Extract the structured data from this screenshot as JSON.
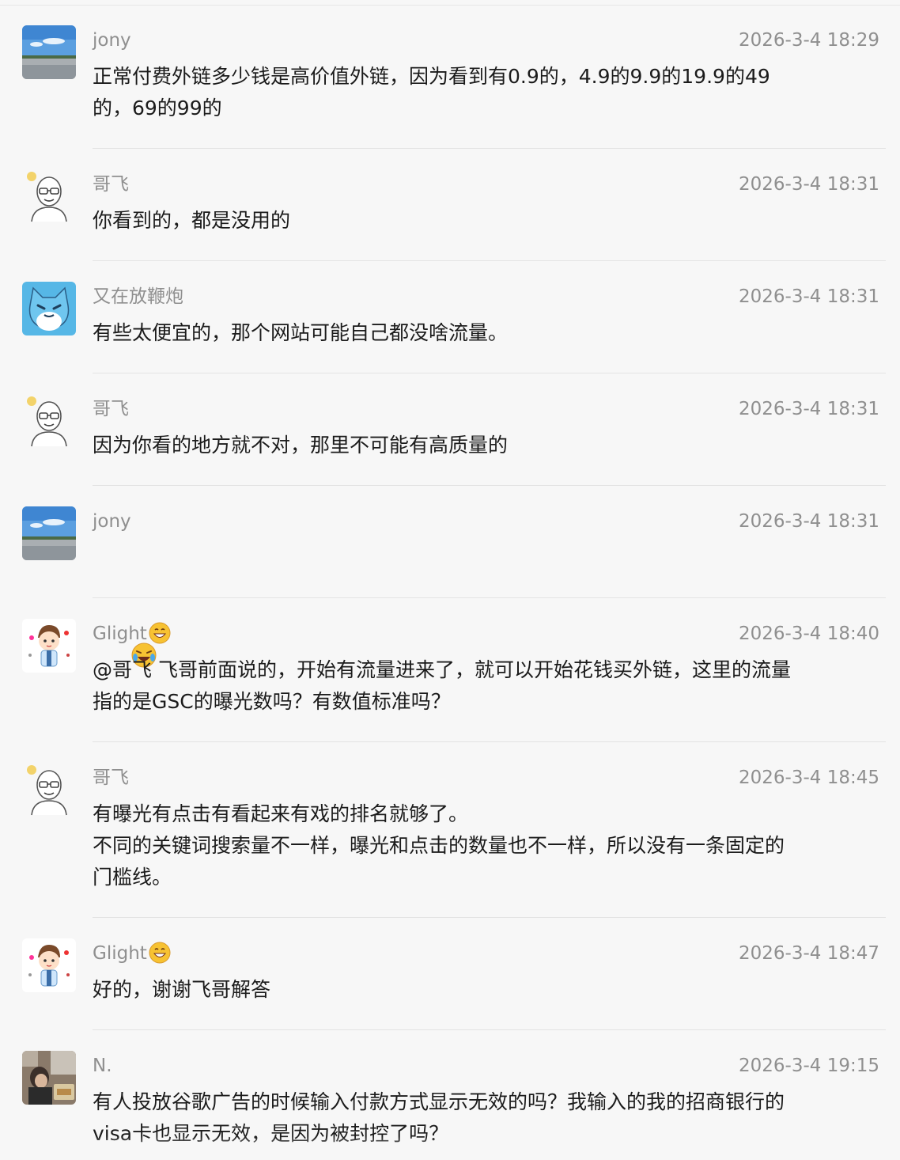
{
  "messages": [
    {
      "name": "jony",
      "time": "2026-3-4 18:29",
      "text": "正常付费外链多少钱是高价值外链，因为看到有0.9的，4.9的9.9的19.9的49\n的，69的99的",
      "avatar": "lake-avatar"
    },
    {
      "name": "哥飞",
      "time": "2026-3-4 18:31",
      "text": "你看到的，都是没用的",
      "avatar": "bald-man-avatar"
    },
    {
      "name": "又在放鞭炮",
      "time": "2026-3-4 18:31",
      "text": "有些太便宜的，那个网站可能自己都没啥流量。",
      "avatar": "blue-cat-avatar"
    },
    {
      "name": "哥飞",
      "time": "2026-3-4 18:31",
      "text": "因为你看的地方就不对，那里不可能有高质量的",
      "avatar": "bald-man-avatar"
    },
    {
      "name": "jony",
      "time": "2026-3-4 18:31",
      "text": "",
      "emoji": "laughing-tears-emoji",
      "avatar": "lake-avatar"
    },
    {
      "name": "Glight",
      "name_emoji": "grinning-face-emoji",
      "time": "2026-3-4 18:40",
      "text": "@哥飞 飞哥前面说的，开始有流量进来了，就可以开始花钱买外链，这里的流量\n指的是GSC的曝光数吗？有数值标准吗？",
      "avatar": "cartoon-boy-avatar"
    },
    {
      "name": "哥飞",
      "time": "2026-3-4 18:45",
      "text": "有曝光有点击有看起来有戏的排名就够了。\n不同的关键词搜索量不一样，曝光和点击的数量也不一样，所以没有一条固定的\n门槛线。",
      "avatar": "bald-man-avatar"
    },
    {
      "name": "Glight",
      "name_emoji": "grinning-face-emoji",
      "time": "2026-3-4 18:47",
      "text": "好的，谢谢飞哥解答",
      "avatar": "cartoon-boy-avatar"
    },
    {
      "name": "N.",
      "time": "2026-3-4 19:15",
      "text": "有人投放谷歌广告的时候输入付款方式显示无效的吗？我输入的我的招商银行的\nvisa卡也显示无效，是因为被封控了吗？",
      "avatar": "photo-avatar"
    }
  ],
  "colors": {
    "background": "#f7f7f7",
    "meta_text": "#8f8f8f",
    "body_text": "#1b1b1b",
    "divider": "#e3e3e3"
  }
}
